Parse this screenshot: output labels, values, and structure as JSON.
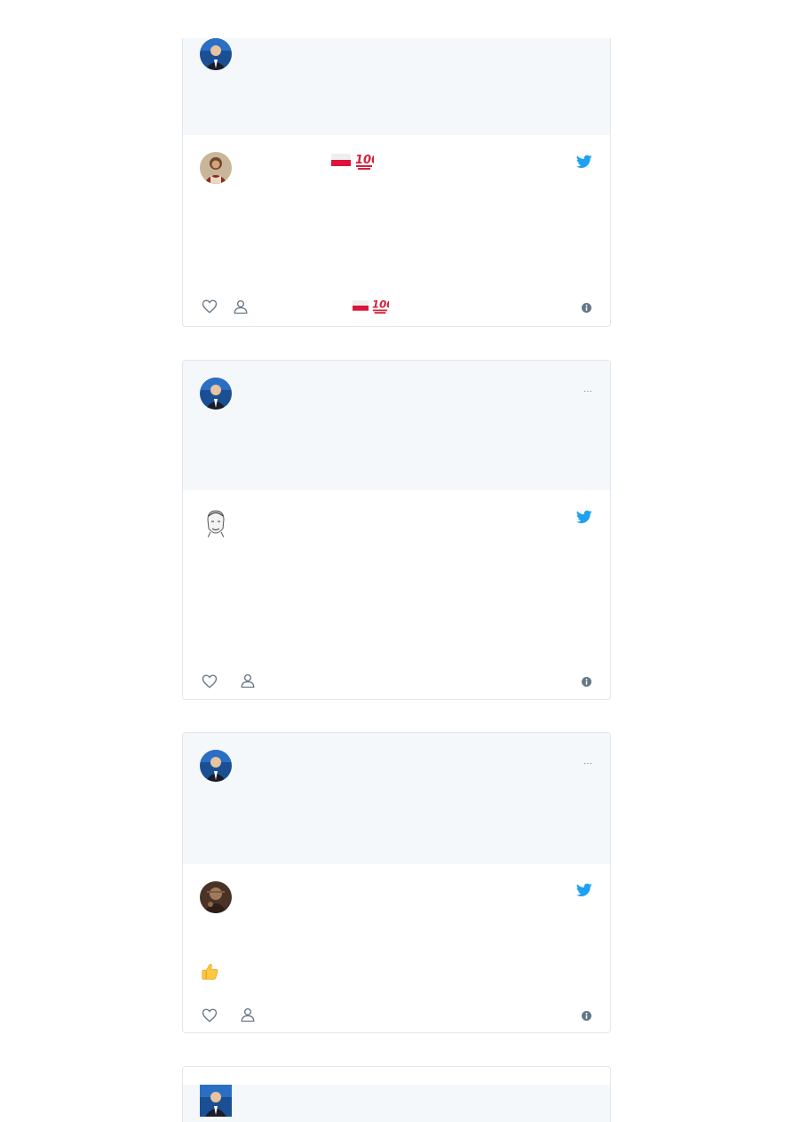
{
  "colors": {
    "page_bg": "#ffffff",
    "card_border": "#e1e8ed",
    "reply_bg": "#f5f8fa",
    "twitter_blue": "#1da1f2",
    "icon_gray": "#657786",
    "flag_red": "#dc143c",
    "hundred_red": "#d5213a"
  },
  "icons": {
    "twitter": "twitter-bird-icon",
    "like": "heart-icon",
    "profile": "person-icon",
    "info": "info-icon",
    "more": "ellipsis-icon",
    "flag": "poland-flag-emoji",
    "hundred": "hundred-points-emoji",
    "thumbs": "thumbs-up-emoji"
  },
  "cards": [
    {
      "reply_author": "",
      "tweet_author": "",
      "tweet_text": "",
      "has_flags": true
    },
    {
      "reply_author": "",
      "tweet_author": "",
      "tweet_text": ""
    },
    {
      "reply_author": "",
      "tweet_author": "",
      "tweet_text": "",
      "emoji_line": "👍"
    }
  ],
  "more_label": "···"
}
